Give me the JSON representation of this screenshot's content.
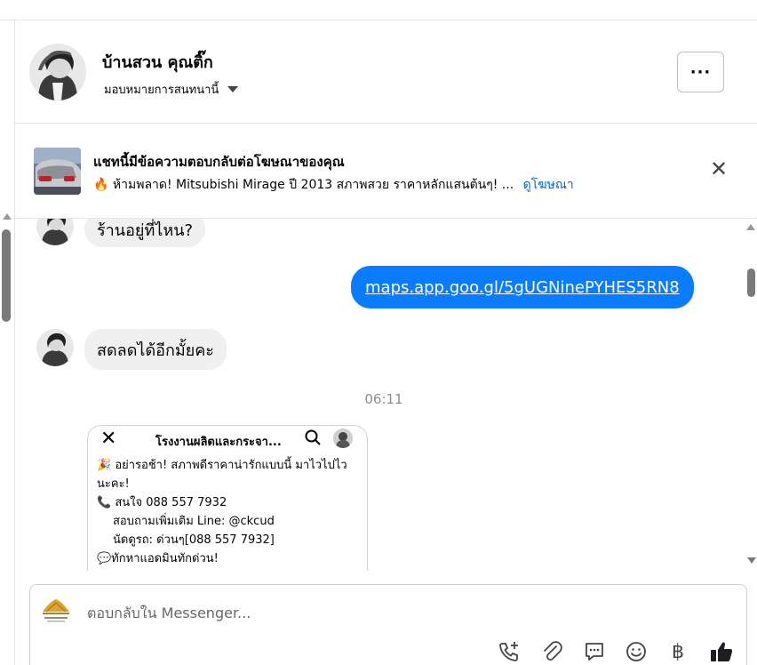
{
  "header": {
    "name": "บ้านสวน คุณติ๊ก",
    "assign_label": "มอบหมายการสนทนานี้",
    "more_label": "···"
  },
  "ad_notice": {
    "title": "แชทนี้มีข้อความตอบกลับต่อโฆษณาของคุณ",
    "emoji": "🔥",
    "text": "ห้ามพลาด! Mitsubishi Mirage ปี 2013 สภาพสวย ราคาหลักแสนต้นๆ! ...",
    "link": "ดูโฆษณา",
    "close": "✕"
  },
  "messages": {
    "in_1": "ร้านอยู่ที่ไหน?",
    "out_1": "maps.app.goo.gl/5gUGNinePYHES5RN8",
    "in_2": "สดลดได้อีกมั้ยคะ",
    "time": "06:11"
  },
  "shared_card": {
    "title": "โรงงานผลิตและกระจา...",
    "lines": {
      "l1": "🎉 อย่ารอช้า! สภาพดีราคาน่ารักแบบนี้ มาไวไปไว",
      "l2": "นะคะ!",
      "l3": "📞 สนใจ 088  557 7932",
      "l4": "สอบถามเพิ่มเติม Line: @ckcud",
      "l5": "นัดดูรถ: ด่วนๆ[088 557 7932]",
      "l6": "💬ทักหาแอดมินทักด่วน!"
    }
  },
  "composer": {
    "placeholder": "ตอบกลับใน Messenger..."
  },
  "toolbar": {
    "icons": [
      "call-add-icon",
      "attachment-icon",
      "comment-icon",
      "emoji-icon",
      "baht-icon",
      "like-icon"
    ],
    "baht": "฿"
  },
  "colors": {
    "accent": "#0a7cff",
    "link": "#0064d1",
    "bubble_in": "#f0f0f0",
    "border": "#e4e6eb"
  }
}
